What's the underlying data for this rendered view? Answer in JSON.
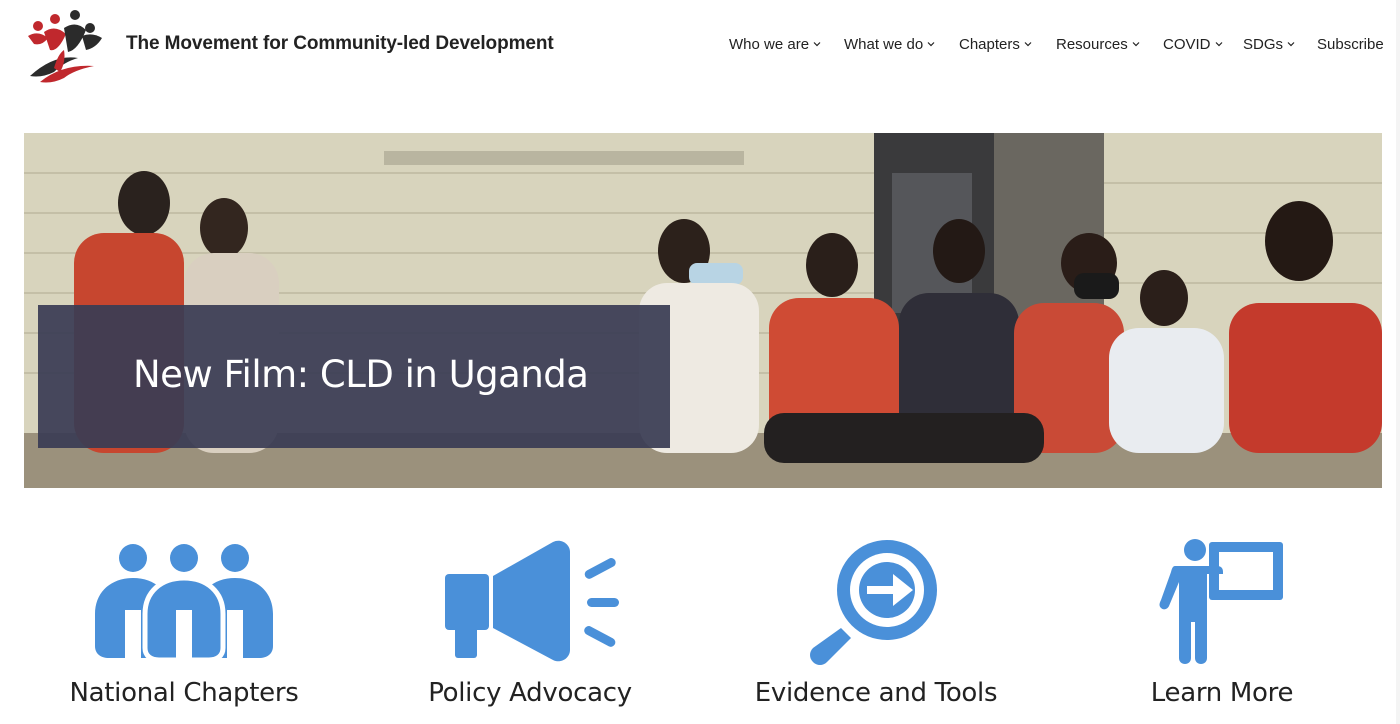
{
  "header": {
    "site_title": "The Movement for Community-led Development",
    "nav": [
      {
        "label": "Who we are",
        "has_dropdown": true
      },
      {
        "label": "What we do",
        "has_dropdown": true
      },
      {
        "label": "Chapters",
        "has_dropdown": true
      },
      {
        "label": "Resources",
        "has_dropdown": true
      },
      {
        "label": "COVID",
        "has_dropdown": true
      },
      {
        "label": "SDGs",
        "has_dropdown": true
      },
      {
        "label": "Subscribe",
        "has_dropdown": false
      }
    ]
  },
  "hero": {
    "caption": "New Film: CLD in Uganda"
  },
  "features": [
    {
      "label": "National Chapters",
      "icon": "people-group-icon"
    },
    {
      "label": "Policy Advocacy",
      "icon": "megaphone-icon"
    },
    {
      "label": "Evidence and Tools",
      "icon": "magnifier-arrow-icon"
    },
    {
      "label": "Learn More",
      "icon": "presenter-board-icon"
    }
  ],
  "colors": {
    "icon_blue": "#4a90d9",
    "caption_bg": "#3a3c54",
    "logo_red": "#c0282d",
    "logo_dark": "#2b2b2b"
  }
}
